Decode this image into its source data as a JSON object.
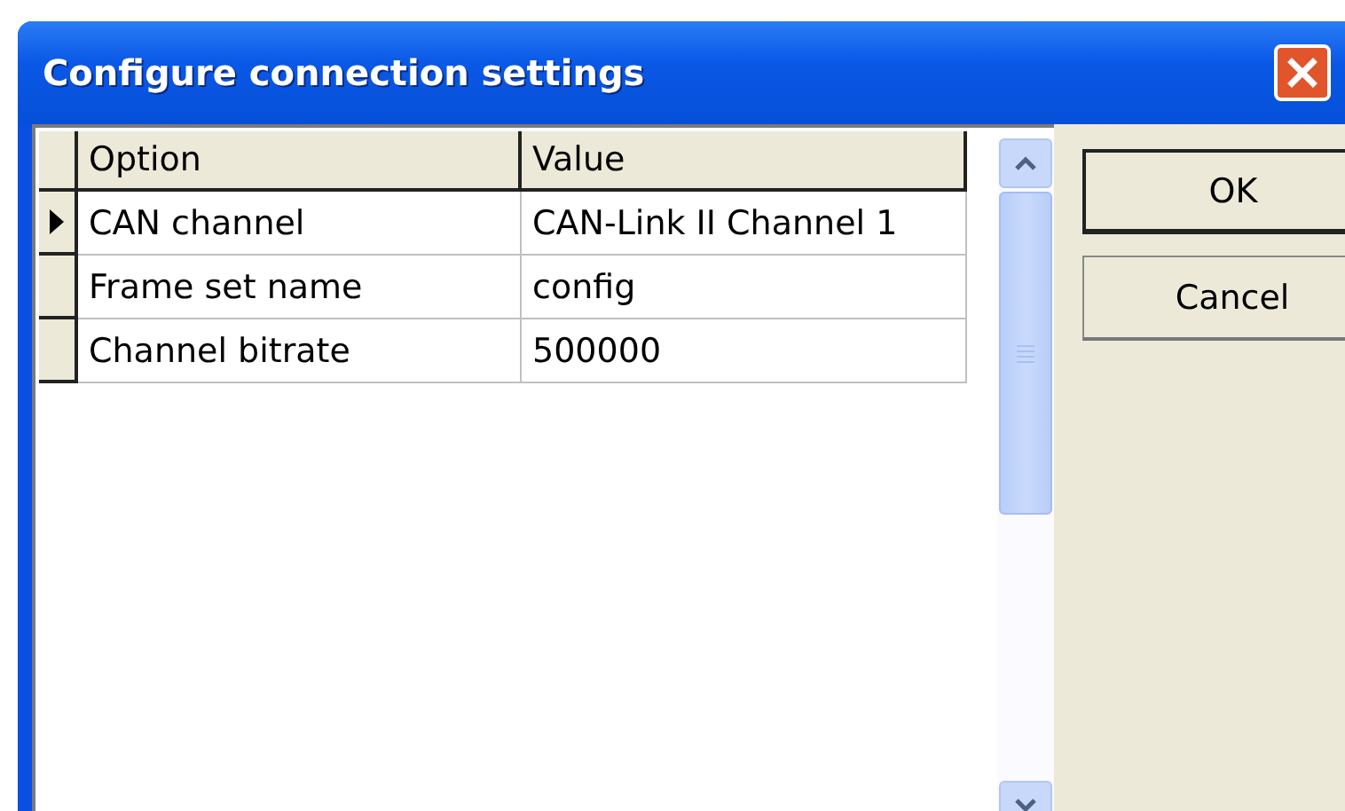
{
  "window": {
    "title": "Configure connection settings"
  },
  "grid": {
    "columns": [
      "Option",
      "Value"
    ],
    "rows": [
      {
        "option": "CAN channel",
        "value": "CAN-Link II Channel 1",
        "selected": true
      },
      {
        "option": "Frame set name",
        "value": "config",
        "selected": false
      },
      {
        "option": "Channel bitrate",
        "value": "500000",
        "selected": false
      }
    ]
  },
  "buttons": [
    {
      "label": "OK",
      "default": true
    },
    {
      "label": "Cancel",
      "default": false
    }
  ]
}
